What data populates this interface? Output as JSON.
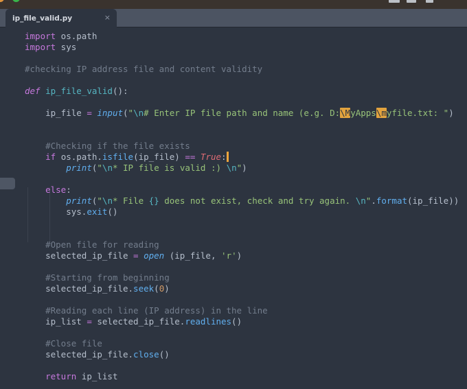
{
  "window": {
    "titlebar_color": "#3a332e",
    "traffic_lights": [
      "orange",
      "green"
    ],
    "toolbar_icon_remnants": 3
  },
  "tabbar": {
    "background": "#4c5462",
    "tab": {
      "label": "ip_file_valid.py",
      "close_glyph": "×",
      "active": true
    }
  },
  "editor": {
    "background": "#2d3440",
    "cursor_color": "#eda53c",
    "syntax_colors": {
      "keyword": "#c678dd",
      "function": "#61afef",
      "definition_name": "#56b6c2",
      "string": "#98c379",
      "escape": "#56b6c2",
      "invalid_escape_bg": "#e2a33e",
      "number": "#d19a66",
      "boolean": "#e06c75",
      "comment": "#737d8c",
      "plain": "#b6bfcc"
    },
    "lines": [
      {
        "segments": [
          {
            "c": "kw",
            "t": "import"
          },
          {
            "c": "plain",
            "t": " os.path"
          }
        ]
      },
      {
        "segments": [
          {
            "c": "kw",
            "t": "import"
          },
          {
            "c": "plain",
            "t": " sys"
          }
        ]
      },
      {
        "segments": []
      },
      {
        "segments": [
          {
            "c": "com",
            "t": "#checking IP address file and content validity"
          }
        ]
      },
      {
        "segments": []
      },
      {
        "segments": [
          {
            "c": "kwi",
            "t": "def"
          },
          {
            "c": "plain",
            "t": " "
          },
          {
            "c": "defname",
            "t": "ip_file_valid"
          },
          {
            "c": "plain",
            "t": "():"
          }
        ]
      },
      {
        "segments": []
      },
      {
        "segments": [
          {
            "c": "plain",
            "t": "    ip_file "
          },
          {
            "c": "kw",
            "t": "="
          },
          {
            "c": "plain",
            "t": " "
          },
          {
            "c": "fni",
            "t": "input"
          },
          {
            "c": "plain",
            "t": "("
          },
          {
            "c": "str",
            "t": "\""
          },
          {
            "c": "esc",
            "t": "\\n"
          },
          {
            "c": "str",
            "t": "# Enter IP file path and name (e.g. D:"
          },
          {
            "c": "escbad",
            "t": "\\M"
          },
          {
            "c": "str",
            "t": "yApps"
          },
          {
            "c": "escbad",
            "t": "\\m"
          },
          {
            "c": "str",
            "t": "yfile.txt: \""
          },
          {
            "c": "plain",
            "t": ")"
          }
        ]
      },
      {
        "segments": []
      },
      {
        "segments": []
      },
      {
        "segments": [
          {
            "c": "com",
            "t": "    #Checking if the file exists"
          }
        ]
      },
      {
        "segments": [
          {
            "c": "plain",
            "t": "    "
          },
          {
            "c": "kw",
            "t": "if"
          },
          {
            "c": "plain",
            "t": " os.path."
          },
          {
            "c": "fn",
            "t": "isfile"
          },
          {
            "c": "plain",
            "t": "(ip_file) "
          },
          {
            "c": "kw",
            "t": "=="
          },
          {
            "c": "plain",
            "t": " "
          },
          {
            "c": "bool",
            "t": "True"
          },
          {
            "c": "plain",
            "t": ":"
          },
          {
            "c": "caret",
            "t": ""
          }
        ]
      },
      {
        "segments": [
          {
            "c": "plain",
            "t": "        "
          },
          {
            "c": "fni",
            "t": "print"
          },
          {
            "c": "plain",
            "t": "("
          },
          {
            "c": "str",
            "t": "\""
          },
          {
            "c": "esc",
            "t": "\\n"
          },
          {
            "c": "str",
            "t": "* IP file is valid :) "
          },
          {
            "c": "esc",
            "t": "\\n"
          },
          {
            "c": "str",
            "t": "\""
          },
          {
            "c": "plain",
            "t": ")"
          }
        ]
      },
      {
        "segments": []
      },
      {
        "segments": [
          {
            "c": "plain",
            "t": "    "
          },
          {
            "c": "kw",
            "t": "else"
          },
          {
            "c": "plain",
            "t": ":"
          }
        ]
      },
      {
        "segments": [
          {
            "c": "plain",
            "t": "        "
          },
          {
            "c": "fni",
            "t": "print"
          },
          {
            "c": "plain",
            "t": "("
          },
          {
            "c": "str",
            "t": "\""
          },
          {
            "c": "esc",
            "t": "\\n"
          },
          {
            "c": "str",
            "t": "* File "
          },
          {
            "c": "esc",
            "t": "{}"
          },
          {
            "c": "str",
            "t": " does not exist, check and try again. "
          },
          {
            "c": "esc",
            "t": "\\n"
          },
          {
            "c": "str",
            "t": "\""
          },
          {
            "c": "plain",
            "t": "."
          },
          {
            "c": "fn",
            "t": "format"
          },
          {
            "c": "plain",
            "t": "(ip_file))"
          }
        ]
      },
      {
        "segments": [
          {
            "c": "plain",
            "t": "        sys."
          },
          {
            "c": "fn",
            "t": "exit"
          },
          {
            "c": "plain",
            "t": "()"
          }
        ]
      },
      {
        "segments": []
      },
      {
        "segments": []
      },
      {
        "segments": [
          {
            "c": "com",
            "t": "    #Open file for reading"
          }
        ]
      },
      {
        "segments": [
          {
            "c": "plain",
            "t": "    selected_ip_file "
          },
          {
            "c": "kw",
            "t": "="
          },
          {
            "c": "plain",
            "t": " "
          },
          {
            "c": "fni",
            "t": "open"
          },
          {
            "c": "plain",
            "t": " (ip_file, "
          },
          {
            "c": "str",
            "t": "'r'"
          },
          {
            "c": "plain",
            "t": ")"
          }
        ]
      },
      {
        "segments": []
      },
      {
        "segments": [
          {
            "c": "com",
            "t": "    #Starting from beginning"
          }
        ]
      },
      {
        "segments": [
          {
            "c": "plain",
            "t": "    selected_ip_file."
          },
          {
            "c": "fn",
            "t": "seek"
          },
          {
            "c": "plain",
            "t": "("
          },
          {
            "c": "num",
            "t": "0"
          },
          {
            "c": "plain",
            "t": ")"
          }
        ]
      },
      {
        "segments": []
      },
      {
        "segments": [
          {
            "c": "com",
            "t": "    #Reading each line (IP address) in the line"
          }
        ]
      },
      {
        "segments": [
          {
            "c": "plain",
            "t": "    ip_list "
          },
          {
            "c": "kw",
            "t": "="
          },
          {
            "c": "plain",
            "t": " selected_ip_file."
          },
          {
            "c": "fn",
            "t": "readlines"
          },
          {
            "c": "plain",
            "t": "()"
          }
        ]
      },
      {
        "segments": []
      },
      {
        "segments": [
          {
            "c": "com",
            "t": "    #Close file"
          }
        ]
      },
      {
        "segments": [
          {
            "c": "plain",
            "t": "    selected_ip_file."
          },
          {
            "c": "fn",
            "t": "close"
          },
          {
            "c": "plain",
            "t": "()"
          }
        ]
      },
      {
        "segments": []
      },
      {
        "segments": [
          {
            "c": "plain",
            "t": "    "
          },
          {
            "c": "kw",
            "t": "return"
          },
          {
            "c": "plain",
            "t": " ip_list"
          }
        ]
      }
    ]
  }
}
